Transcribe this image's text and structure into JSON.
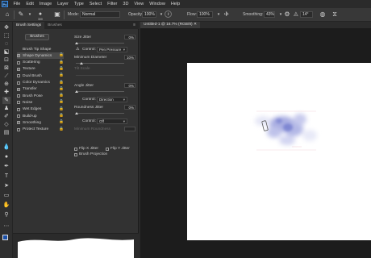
{
  "app": {
    "logo": "Ps"
  },
  "menu": [
    "File",
    "Edit",
    "Image",
    "Layer",
    "Type",
    "Select",
    "Filter",
    "3D",
    "View",
    "Window",
    "Help"
  ],
  "options_bar": {
    "brush_size": "300",
    "mode_label": "Mode:",
    "mode_value": "Normal",
    "opacity_label": "Opacity:",
    "opacity_value": "100%",
    "flow_label": "Flow:",
    "flow_value": "100%",
    "smoothing_label": "Smoothing:",
    "smoothing_value": "43%",
    "angle_value": "14°"
  },
  "panel": {
    "tabs": [
      "Brush Settings",
      "Brushes"
    ],
    "brushes_button": "Brushes",
    "options": [
      {
        "label": "Brush Tip Shape",
        "checked": null,
        "selected": false,
        "lock": false
      },
      {
        "label": "Shape Dynamics",
        "checked": true,
        "selected": true,
        "lock": true
      },
      {
        "label": "Scattering",
        "checked": false,
        "selected": false,
        "lock": true
      },
      {
        "label": "Texture",
        "checked": true,
        "selected": false,
        "lock": true
      },
      {
        "label": "Dual Brush",
        "checked": false,
        "selected": false,
        "lock": true
      },
      {
        "label": "Color Dynamics",
        "checked": false,
        "selected": false,
        "lock": true
      },
      {
        "label": "Transfer",
        "checked": true,
        "selected": false,
        "lock": true
      },
      {
        "label": "Brush Pose",
        "checked": false,
        "selected": false,
        "lock": true
      },
      {
        "label": "Noise",
        "checked": false,
        "selected": false,
        "lock": true
      },
      {
        "label": "Wet Edges",
        "checked": false,
        "selected": false,
        "lock": true
      },
      {
        "label": "Build-up",
        "checked": false,
        "selected": false,
        "lock": true
      },
      {
        "label": "Smoothing",
        "checked": true,
        "selected": false,
        "lock": true
      },
      {
        "label": "Protect Texture",
        "checked": false,
        "selected": false,
        "lock": true
      }
    ],
    "settings": {
      "size_jitter_label": "Size Jitter",
      "size_jitter_value": "0%",
      "control_label": "Control:",
      "control_pen": "Pen Pressure",
      "min_diameter_label": "Minimum Diameter",
      "min_diameter_value": "10%",
      "tilt_scale_label": "Tilt Scale",
      "angle_jitter_label": "Angle Jitter",
      "angle_jitter_value": "0%",
      "control_direction": "Direction",
      "roundness_jitter_label": "Roundness Jitter",
      "roundness_jitter_value": "0%",
      "control_off": "Off",
      "min_roundness_label": "Minimum Roundness",
      "flip_x": "Flip X Jitter",
      "flip_y": "Flip Y Jitter",
      "brush_projection": "Brush Projection"
    }
  },
  "document": {
    "tab_title": "Untitled-1 @ 16.7% (RGB/8)"
  },
  "colors": {
    "foreground": "#1a4fa8",
    "background": "#ffffff",
    "stroke": "#6f7fd0"
  }
}
